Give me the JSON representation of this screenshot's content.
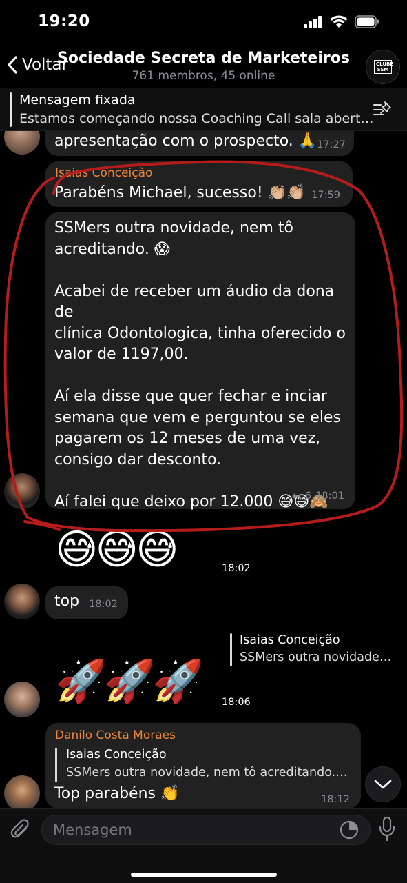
{
  "status_bar": {
    "time": "19:20"
  },
  "nav": {
    "back_label": "Voltar",
    "title": "Sociedade Secreta de Marketeiros",
    "subtitle": "761 membros, 45 online",
    "avatar_text": "CLUBE SSM"
  },
  "pinned": {
    "title": "Mensagem fixada",
    "text": "Estamos começando nossa Coaching Call sala abert…"
  },
  "messages": {
    "m1": {
      "text": "apresentação com o prospecto. 🙏",
      "time": "17:27"
    },
    "m2": {
      "sender": "Isaias Conceição",
      "text": "Parabéns Michael, sucesso! 👏🏼👏🏼",
      "time": "17:59"
    },
    "m3": {
      "text": "SSMers outra novidade, nem tô\nacreditando. 😱\n\nAcabei de receber um áudio da dona de\nclínica Odontologica, tinha oferecido o\nvalor de 1197,00.\n\nAí ela disse que quer fechar e inciar\nsemana que vem e perguntou se eles\npagarem os 12 meses de uma vez,\nconsigo dar desconto.\n\nAí falei que deixo por 12.000 😅😅🙈",
      "reply_count": "6",
      "time": "18:01"
    },
    "m4": {
      "emojis": "😅😅😅",
      "time": "18:02"
    },
    "m5": {
      "text": "top",
      "time": "18:02"
    },
    "m6": {
      "reply_sender": "Isaias Conceição",
      "reply_text": "SSMers outra novidade…",
      "emojis": "🚀🚀🚀",
      "time": "18:06"
    },
    "m7": {
      "sender": "Danilo Costa Moraes",
      "reply_sender": "Isaias Conceição",
      "reply_text": "SSMers outra novidade, nem tô acreditando.…",
      "text": "Top parabéns 👏",
      "time": "18:12"
    }
  },
  "input": {
    "placeholder": "Mensagem"
  },
  "colors": {
    "accent": "#f0863c",
    "annotation": "#b51c1c",
    "bubble": "#212121"
  }
}
